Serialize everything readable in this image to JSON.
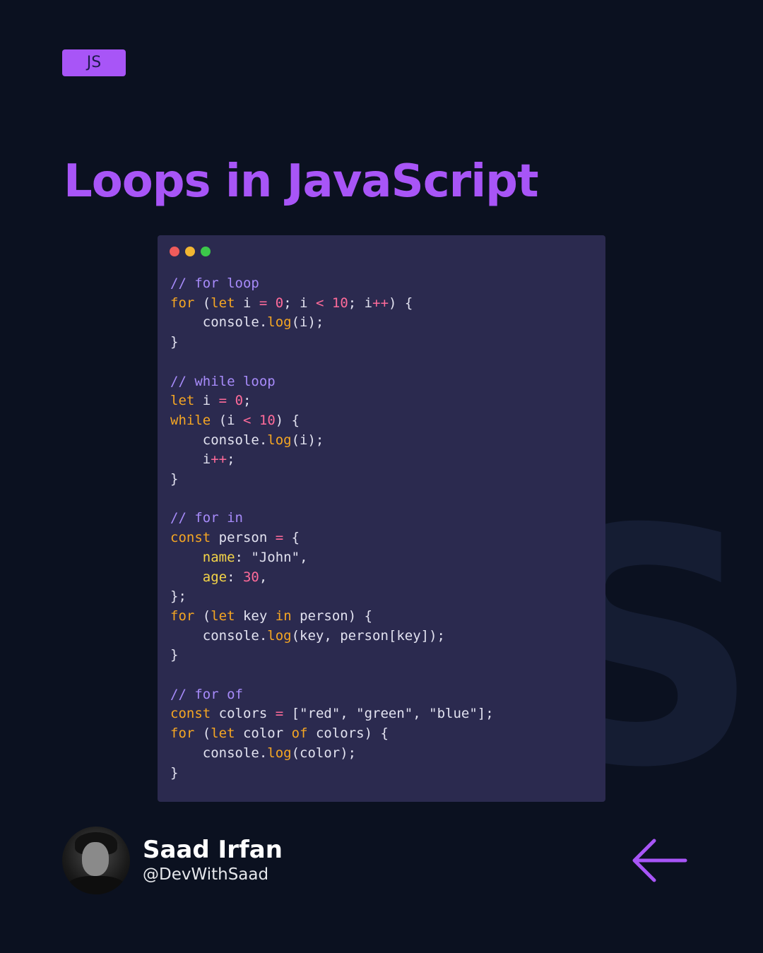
{
  "tag": "JS",
  "title": "Loops in JavaScript",
  "background_letter": "S",
  "author": {
    "name": "Saad Irfan",
    "handle": "@DevWithSaad"
  },
  "colors": {
    "background": "#0b1120",
    "accent": "#a855f7",
    "code_bg": "#2b2a4f"
  },
  "icons": {
    "navigation": "arrow-left-icon"
  },
  "code": [
    [
      {
        "t": "// for loop",
        "c": "comment"
      }
    ],
    [
      {
        "t": "for",
        "c": "kw"
      },
      {
        "t": " ("
      },
      {
        "t": "let",
        "c": "kw"
      },
      {
        "t": " i "
      },
      {
        "t": "=",
        "c": "op"
      },
      {
        "t": " "
      },
      {
        "t": "0",
        "c": "num"
      },
      {
        "t": "; i "
      },
      {
        "t": "<",
        "c": "op"
      },
      {
        "t": " "
      },
      {
        "t": "10",
        "c": "num"
      },
      {
        "t": "; i"
      },
      {
        "t": "++",
        "c": "op"
      },
      {
        "t": ") {"
      }
    ],
    [
      {
        "t": "    console."
      },
      {
        "t": "log",
        "c": "fn"
      },
      {
        "t": "(i);"
      }
    ],
    [
      {
        "t": "}"
      }
    ],
    [],
    [
      {
        "t": "// while loop",
        "c": "comment"
      }
    ],
    [
      {
        "t": "let",
        "c": "kw"
      },
      {
        "t": " i "
      },
      {
        "t": "=",
        "c": "op"
      },
      {
        "t": " "
      },
      {
        "t": "0",
        "c": "num"
      },
      {
        "t": ";"
      }
    ],
    [
      {
        "t": "while",
        "c": "kw"
      },
      {
        "t": " (i "
      },
      {
        "t": "<",
        "c": "op"
      },
      {
        "t": " "
      },
      {
        "t": "10",
        "c": "num"
      },
      {
        "t": ") {"
      }
    ],
    [
      {
        "t": "    console."
      },
      {
        "t": "log",
        "c": "fn"
      },
      {
        "t": "(i);"
      }
    ],
    [
      {
        "t": "    i"
      },
      {
        "t": "++",
        "c": "op"
      },
      {
        "t": ";"
      }
    ],
    [
      {
        "t": "}"
      }
    ],
    [],
    [
      {
        "t": "// for in",
        "c": "comment"
      }
    ],
    [
      {
        "t": "const",
        "c": "kw"
      },
      {
        "t": " person "
      },
      {
        "t": "=",
        "c": "op"
      },
      {
        "t": " {"
      }
    ],
    [
      {
        "t": "    "
      },
      {
        "t": "name",
        "c": "prop"
      },
      {
        "t": ": "
      },
      {
        "t": "\"John\"",
        "c": "str"
      },
      {
        "t": ","
      }
    ],
    [
      {
        "t": "    "
      },
      {
        "t": "age",
        "c": "prop"
      },
      {
        "t": ": "
      },
      {
        "t": "30",
        "c": "num"
      },
      {
        "t": ","
      }
    ],
    [
      {
        "t": "};"
      }
    ],
    [
      {
        "t": "for",
        "c": "kw"
      },
      {
        "t": " ("
      },
      {
        "t": "let",
        "c": "kw"
      },
      {
        "t": " key "
      },
      {
        "t": "in",
        "c": "kw"
      },
      {
        "t": " person) {"
      }
    ],
    [
      {
        "t": "    console."
      },
      {
        "t": "log",
        "c": "fn"
      },
      {
        "t": "(key, person[key]);"
      }
    ],
    [
      {
        "t": "}"
      }
    ],
    [],
    [
      {
        "t": "// for of",
        "c": "comment"
      }
    ],
    [
      {
        "t": "const",
        "c": "kw"
      },
      {
        "t": " colors "
      },
      {
        "t": "=",
        "c": "op"
      },
      {
        "t": " ["
      },
      {
        "t": "\"red\"",
        "c": "str"
      },
      {
        "t": ", "
      },
      {
        "t": "\"green\"",
        "c": "str"
      },
      {
        "t": ", "
      },
      {
        "t": "\"blue\"",
        "c": "str"
      },
      {
        "t": "];"
      }
    ],
    [
      {
        "t": "for",
        "c": "kw"
      },
      {
        "t": " ("
      },
      {
        "t": "let",
        "c": "kw"
      },
      {
        "t": " color "
      },
      {
        "t": "of",
        "c": "kw"
      },
      {
        "t": " colors) {"
      }
    ],
    [
      {
        "t": "    console."
      },
      {
        "t": "log",
        "c": "fn"
      },
      {
        "t": "(color);"
      }
    ],
    [
      {
        "t": "}"
      }
    ]
  ]
}
